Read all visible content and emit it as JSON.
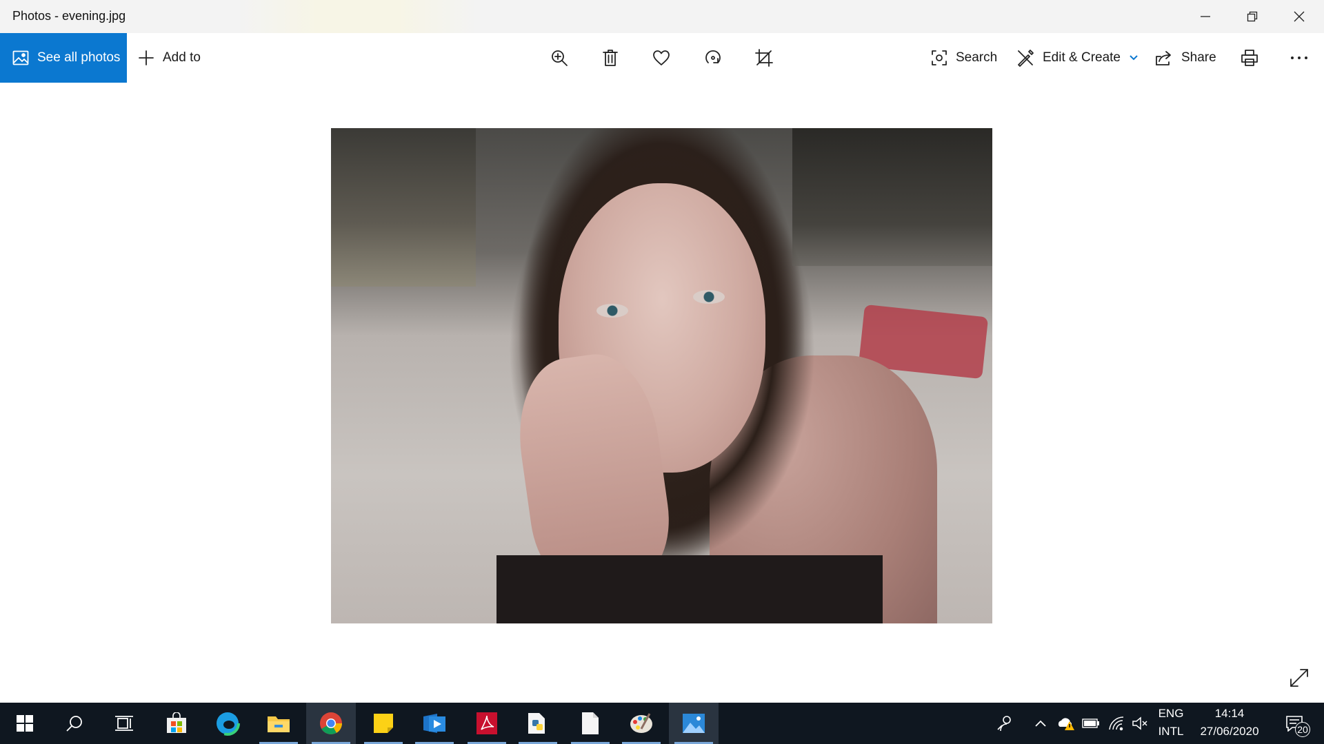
{
  "window": {
    "title": "Photos - evening.jpg",
    "controls": {
      "minimize": "minimize-icon",
      "restore": "restore-icon",
      "close": "close-icon"
    }
  },
  "toolbar": {
    "see_all_photos": "See all photos",
    "add_to": "Add to",
    "zoom_icon": "zoom-in-icon",
    "delete_icon": "trash-icon",
    "favorite_icon": "heart-icon",
    "rotate_icon": "rotate-icon",
    "crop_icon": "crop-icon",
    "search": "Search",
    "edit_create": "Edit & Create",
    "share": "Share",
    "print_icon": "printer-icon",
    "more_icon": "more-icon"
  },
  "accent_color": "#0b78d0",
  "taskbar": {
    "apps": [
      {
        "name": "start",
        "icon": "windows-icon"
      },
      {
        "name": "search",
        "icon": "search-icon"
      },
      {
        "name": "task-view",
        "icon": "task-view-icon"
      },
      {
        "name": "microsoft-store",
        "icon": "store-icon"
      },
      {
        "name": "edge",
        "icon": "edge-icon"
      },
      {
        "name": "file-explorer",
        "icon": "folder-icon"
      },
      {
        "name": "chrome",
        "icon": "chrome-icon"
      },
      {
        "name": "sticky-notes",
        "icon": "sticky-notes-icon"
      },
      {
        "name": "media-player",
        "icon": "media-player-icon"
      },
      {
        "name": "acrobat",
        "icon": "pdf-icon"
      },
      {
        "name": "python",
        "icon": "python-icon"
      },
      {
        "name": "notepad",
        "icon": "document-icon"
      },
      {
        "name": "paint",
        "icon": "palette-icon"
      },
      {
        "name": "photos",
        "icon": "photos-icon"
      }
    ],
    "tray": {
      "language_top": "ENG",
      "language_bottom": "INTL",
      "time": "14:14",
      "date": "27/06/2020",
      "notification_count": "20"
    }
  }
}
